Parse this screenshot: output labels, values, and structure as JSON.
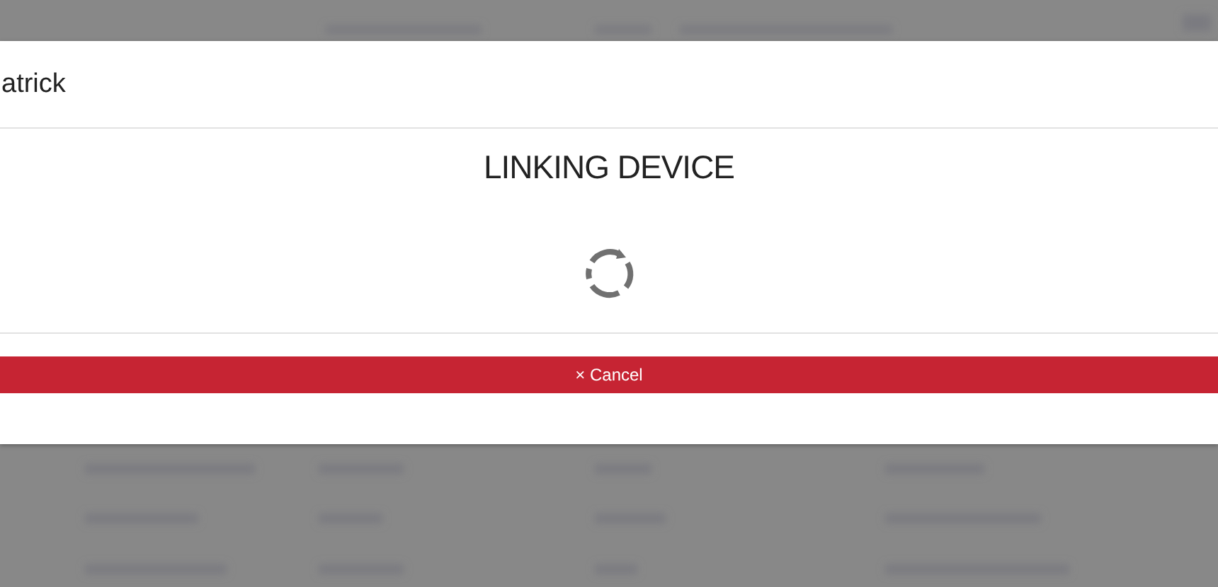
{
  "modal": {
    "header": "atrick",
    "title": "LINKING DEVICE",
    "status": {
      "kind": "loading"
    },
    "cancel_button": "× Cancel"
  }
}
